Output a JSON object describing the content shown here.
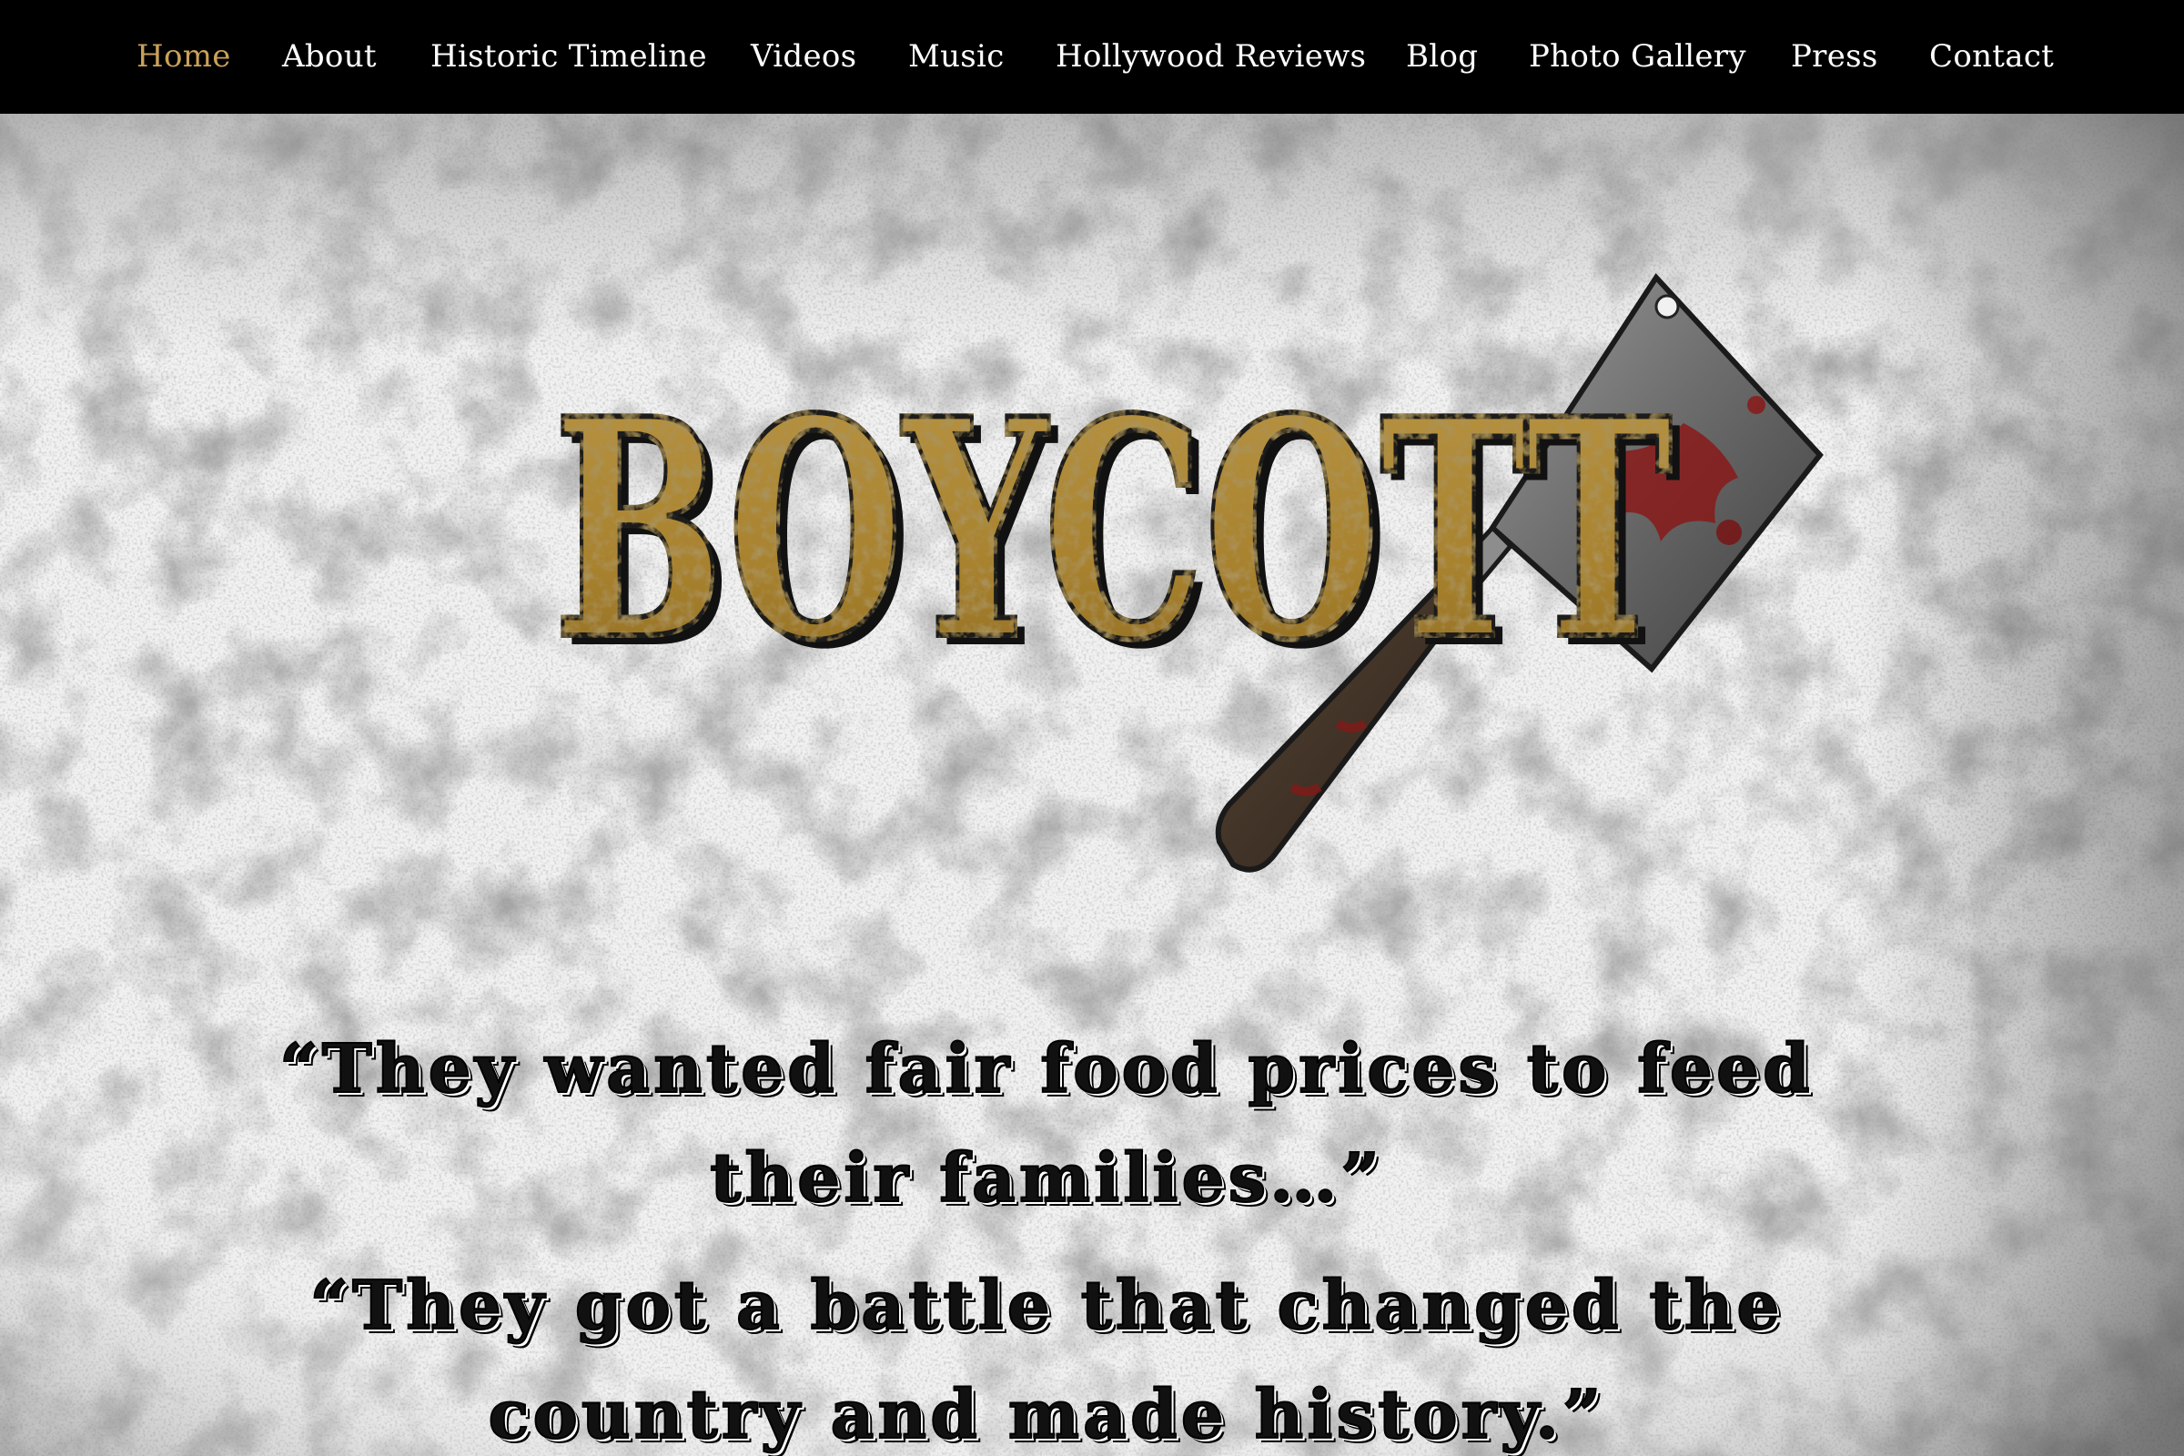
{
  "nav": {
    "items": [
      {
        "label": "Home",
        "active": true
      },
      {
        "label": "About"
      },
      {
        "label": "Historic Timeline"
      },
      {
        "label": "Videos"
      },
      {
        "label": "Music"
      },
      {
        "label": "Hollywood Reviews"
      },
      {
        "label": "Blog"
      },
      {
        "label": "Photo Gallery"
      },
      {
        "label": "Press"
      },
      {
        "label": "Contact"
      }
    ]
  },
  "hero": {
    "logo_text": "BOYCOTT",
    "logo_icon": "meat-cleaver-icon",
    "quote_1": "“They wanted fair food prices to feed their families…”",
    "quote_2": "“They got a battle that changed the country and made history.”"
  },
  "colors": {
    "nav_background": "#000000",
    "nav_text": "#ffffff",
    "nav_active": "#c9a15a",
    "logo_gold": "#a8822e",
    "quote_text": "#111111"
  }
}
